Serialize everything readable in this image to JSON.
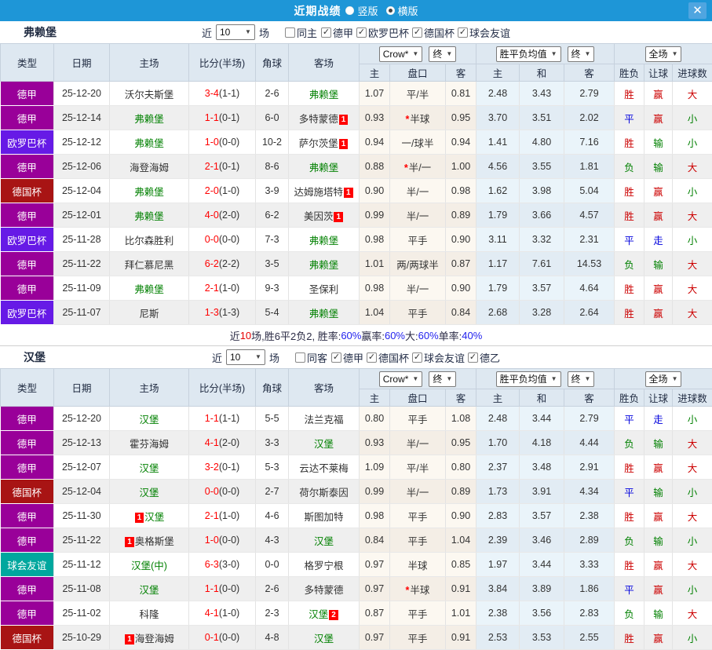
{
  "titlebar": {
    "title": "近期战绩",
    "radios": [
      {
        "label": "竖版",
        "checked": false
      },
      {
        "label": "横版",
        "checked": true
      }
    ],
    "close_label": "✕"
  },
  "filter": {
    "near": "近",
    "games": "场"
  },
  "columns": {
    "type": "类型",
    "date": "日期",
    "home": "主场",
    "score": "比分(半场)",
    "corner": "角球",
    "away": "客场",
    "sub": [
      "主",
      "盘口",
      "客",
      "主",
      "和",
      "客",
      "胜负",
      "让球",
      "进球数"
    ],
    "selects": {
      "bookmaker": "Crow*",
      "final1": "终",
      "avg": "胜平负均值",
      "final2": "终",
      "scope": "全场"
    }
  },
  "league_colors": {
    "德甲": "#990099",
    "欧罗巴杯": "#661ae6",
    "德国杯": "#a81414",
    "球会友谊": "#00a79e"
  },
  "result_colors": {
    "胜": "#cc0000",
    "赢": "#cc0000",
    "大": "#cc0000",
    "平": "#0000dd",
    "走": "#0000dd",
    "负": "#008000",
    "输": "#008000",
    "小": "#008000"
  },
  "accent_colors": {
    "titlebar": "#1e96d7",
    "team_green": "#008000",
    "score_red": "#ff0000"
  },
  "sections": [
    {
      "team": "弗赖堡",
      "count": "10",
      "same": "同主",
      "same_checked": false,
      "leagues": [
        "德甲",
        "欧罗巴杯",
        "德国杯",
        "球会友谊"
      ],
      "summary_parts": [
        {
          "text": "近",
          "color": "#2b2b45"
        },
        {
          "text": "10",
          "color": "#e60000"
        },
        {
          "text": "场,胜6平2负2, 胜率:",
          "color": "#2b2b45"
        },
        {
          "text": "60%",
          "color": "#2222ee"
        },
        {
          "text": " 赢率:",
          "color": "#2b2b45"
        },
        {
          "text": "60%",
          "color": "#2222ee"
        },
        {
          "text": " 大:",
          "color": "#2b2b45"
        },
        {
          "text": "60%",
          "color": "#2222ee"
        },
        {
          "text": " 单率:",
          "color": "#2b2b45"
        },
        {
          "text": "40%",
          "color": "#2222ee"
        }
      ],
      "rows": [
        {
          "type": "德甲",
          "date": "25-12-20",
          "home": "沃尔夫斯堡",
          "home_green": false,
          "home_badge": "",
          "score": "3-4",
          "half": "(1-1)",
          "corner": "2-6",
          "away": "弗赖堡",
          "away_green": true,
          "away_badge": "",
          "ah_home": "1.07",
          "handicap": "平/半",
          "handicap_star": false,
          "ah_away": "0.81",
          "odds_win": "2.48",
          "odds_draw": "3.43",
          "odds_lose": "2.79",
          "res_wdl": "胜",
          "res_ah": "赢",
          "res_goals": "大"
        },
        {
          "type": "德甲",
          "date": "25-12-14",
          "home": "弗赖堡",
          "home_green": true,
          "home_badge": "",
          "score": "1-1",
          "half": "(0-1)",
          "corner": "6-0",
          "away": "多特蒙德",
          "away_green": false,
          "away_badge": "1",
          "ah_home": "0.93",
          "handicap": "半球",
          "handicap_star": true,
          "ah_away": "0.95",
          "odds_win": "3.70",
          "odds_draw": "3.51",
          "odds_lose": "2.02",
          "res_wdl": "平",
          "res_ah": "赢",
          "res_goals": "小"
        },
        {
          "type": "欧罗巴杯",
          "date": "25-12-12",
          "home": "弗赖堡",
          "home_green": true,
          "home_badge": "",
          "score": "1-0",
          "half": "(0-0)",
          "corner": "10-2",
          "away": "萨尔茨堡",
          "away_green": false,
          "away_badge": "1",
          "ah_home": "0.94",
          "handicap": "一/球半",
          "handicap_star": false,
          "ah_away": "0.94",
          "odds_win": "1.41",
          "odds_draw": "4.80",
          "odds_lose": "7.16",
          "res_wdl": "胜",
          "res_ah": "输",
          "res_goals": "小"
        },
        {
          "type": "德甲",
          "date": "25-12-06",
          "home": "海登海姆",
          "home_green": false,
          "home_badge": "",
          "score": "2-1",
          "half": "(0-1)",
          "corner": "8-6",
          "away": "弗赖堡",
          "away_green": true,
          "away_badge": "",
          "ah_home": "0.88",
          "handicap": "半/一",
          "handicap_star": true,
          "ah_away": "1.00",
          "odds_win": "4.56",
          "odds_draw": "3.55",
          "odds_lose": "1.81",
          "res_wdl": "负",
          "res_ah": "输",
          "res_goals": "大"
        },
        {
          "type": "德国杯",
          "date": "25-12-04",
          "home": "弗赖堡",
          "home_green": true,
          "home_badge": "",
          "score": "2-0",
          "half": "(1-0)",
          "corner": "3-9",
          "away": "达姆施塔特",
          "away_green": false,
          "away_badge": "1",
          "ah_home": "0.90",
          "handicap": "半/一",
          "handicap_star": false,
          "ah_away": "0.98",
          "odds_win": "1.62",
          "odds_draw": "3.98",
          "odds_lose": "5.04",
          "res_wdl": "胜",
          "res_ah": "赢",
          "res_goals": "小"
        },
        {
          "type": "德甲",
          "date": "25-12-01",
          "home": "弗赖堡",
          "home_green": true,
          "home_badge": "",
          "score": "4-0",
          "half": "(2-0)",
          "corner": "6-2",
          "away": "美因茨",
          "away_green": false,
          "away_badge": "1",
          "ah_home": "0.99",
          "handicap": "半/一",
          "handicap_star": false,
          "ah_away": "0.89",
          "odds_win": "1.79",
          "odds_draw": "3.66",
          "odds_lose": "4.57",
          "res_wdl": "胜",
          "res_ah": "赢",
          "res_goals": "大"
        },
        {
          "type": "欧罗巴杯",
          "date": "25-11-28",
          "home": "比尔森胜利",
          "home_green": false,
          "home_badge": "",
          "score": "0-0",
          "half": "(0-0)",
          "corner": "7-3",
          "away": "弗赖堡",
          "away_green": true,
          "away_badge": "",
          "ah_home": "0.98",
          "handicap": "平手",
          "handicap_star": false,
          "ah_away": "0.90",
          "odds_win": "3.11",
          "odds_draw": "3.32",
          "odds_lose": "2.31",
          "res_wdl": "平",
          "res_ah": "走",
          "res_goals": "小"
        },
        {
          "type": "德甲",
          "date": "25-11-22",
          "home": "拜仁慕尼黑",
          "home_green": false,
          "home_badge": "",
          "score": "6-2",
          "half": "(2-2)",
          "corner": "3-5",
          "away": "弗赖堡",
          "away_green": true,
          "away_badge": "",
          "ah_home": "1.01",
          "handicap": "两/两球半",
          "handicap_star": false,
          "ah_away": "0.87",
          "odds_win": "1.17",
          "odds_draw": "7.61",
          "odds_lose": "14.53",
          "res_wdl": "负",
          "res_ah": "输",
          "res_goals": "大"
        },
        {
          "type": "德甲",
          "date": "25-11-09",
          "home": "弗赖堡",
          "home_green": true,
          "home_badge": "",
          "score": "2-1",
          "half": "(1-0)",
          "corner": "9-3",
          "away": "圣保利",
          "away_green": false,
          "away_badge": "",
          "ah_home": "0.98",
          "handicap": "半/一",
          "handicap_star": false,
          "ah_away": "0.90",
          "odds_win": "1.79",
          "odds_draw": "3.57",
          "odds_lose": "4.64",
          "res_wdl": "胜",
          "res_ah": "赢",
          "res_goals": "大"
        },
        {
          "type": "欧罗巴杯",
          "date": "25-11-07",
          "home": "尼斯",
          "home_green": false,
          "home_badge": "",
          "score": "1-3",
          "half": "(1-3)",
          "corner": "5-4",
          "away": "弗赖堡",
          "away_green": true,
          "away_badge": "",
          "ah_home": "1.04",
          "handicap": "平手",
          "handicap_star": false,
          "ah_away": "0.84",
          "odds_win": "2.68",
          "odds_draw": "3.28",
          "odds_lose": "2.64",
          "res_wdl": "胜",
          "res_ah": "赢",
          "res_goals": "大"
        }
      ]
    },
    {
      "team": "汉堡",
      "count": "10",
      "same": "同客",
      "same_checked": false,
      "leagues": [
        "德甲",
        "德国杯",
        "球会友谊",
        "德乙"
      ],
      "summary_parts": [],
      "rows": [
        {
          "type": "德甲",
          "date": "25-12-20",
          "home": "汉堡",
          "home_green": true,
          "home_badge": "",
          "score": "1-1",
          "half": "(1-1)",
          "corner": "5-5",
          "away": "法兰克福",
          "away_green": false,
          "away_badge": "",
          "ah_home": "0.80",
          "handicap": "平手",
          "handicap_star": false,
          "ah_away": "1.08",
          "odds_win": "2.48",
          "odds_draw": "3.44",
          "odds_lose": "2.79",
          "res_wdl": "平",
          "res_ah": "走",
          "res_goals": "小"
        },
        {
          "type": "德甲",
          "date": "25-12-13",
          "home": "霍芬海姆",
          "home_green": false,
          "home_badge": "",
          "score": "4-1",
          "half": "(2-0)",
          "corner": "3-3",
          "away": "汉堡",
          "away_green": true,
          "away_badge": "",
          "ah_home": "0.93",
          "handicap": "半/一",
          "handicap_star": false,
          "ah_away": "0.95",
          "odds_win": "1.70",
          "odds_draw": "4.18",
          "odds_lose": "4.44",
          "res_wdl": "负",
          "res_ah": "输",
          "res_goals": "大"
        },
        {
          "type": "德甲",
          "date": "25-12-07",
          "home": "汉堡",
          "home_green": true,
          "home_badge": "",
          "score": "3-2",
          "half": "(0-1)",
          "corner": "5-3",
          "away": "云达不莱梅",
          "away_green": false,
          "away_badge": "",
          "ah_home": "1.09",
          "handicap": "平/半",
          "handicap_star": false,
          "ah_away": "0.80",
          "odds_win": "2.37",
          "odds_draw": "3.48",
          "odds_lose": "2.91",
          "res_wdl": "胜",
          "res_ah": "赢",
          "res_goals": "大"
        },
        {
          "type": "德国杯",
          "date": "25-12-04",
          "home": "汉堡",
          "home_green": true,
          "home_badge": "",
          "score": "0-0",
          "half": "(0-0)",
          "corner": "2-7",
          "away": "荷尔斯泰因",
          "away_green": false,
          "away_badge": "",
          "ah_home": "0.99",
          "handicap": "半/一",
          "handicap_star": false,
          "ah_away": "0.89",
          "odds_win": "1.73",
          "odds_draw": "3.91",
          "odds_lose": "4.34",
          "res_wdl": "平",
          "res_ah": "输",
          "res_goals": "小"
        },
        {
          "type": "德甲",
          "date": "25-11-30",
          "home": "汉堡",
          "home_green": true,
          "home_badge": "1",
          "score": "2-1",
          "half": "(1-0)",
          "corner": "4-6",
          "away": "斯图加特",
          "away_green": false,
          "away_badge": "",
          "ah_home": "0.98",
          "handicap": "平手",
          "handicap_star": false,
          "ah_away": "0.90",
          "odds_win": "2.83",
          "odds_draw": "3.57",
          "odds_lose": "2.38",
          "res_wdl": "胜",
          "res_ah": "赢",
          "res_goals": "大"
        },
        {
          "type": "德甲",
          "date": "25-11-22",
          "home": "奥格斯堡",
          "home_green": false,
          "home_badge": "1",
          "score": "1-0",
          "half": "(0-0)",
          "corner": "4-3",
          "away": "汉堡",
          "away_green": true,
          "away_badge": "",
          "ah_home": "0.84",
          "handicap": "平手",
          "handicap_star": false,
          "ah_away": "1.04",
          "odds_win": "2.39",
          "odds_draw": "3.46",
          "odds_lose": "2.89",
          "res_wdl": "负",
          "res_ah": "输",
          "res_goals": "小"
        },
        {
          "type": "球会友谊",
          "date": "25-11-12",
          "home": "汉堡(中)",
          "home_green": true,
          "home_badge": "",
          "score": "6-3",
          "half": "(3-0)",
          "corner": "0-0",
          "away": "格罗宁根",
          "away_green": false,
          "away_badge": "",
          "ah_home": "0.97",
          "handicap": "半球",
          "handicap_star": false,
          "ah_away": "0.85",
          "odds_win": "1.97",
          "odds_draw": "3.44",
          "odds_lose": "3.33",
          "res_wdl": "胜",
          "res_ah": "赢",
          "res_goals": "大"
        },
        {
          "type": "德甲",
          "date": "25-11-08",
          "home": "汉堡",
          "home_green": true,
          "home_badge": "",
          "score": "1-1",
          "half": "(0-0)",
          "corner": "2-6",
          "away": "多特蒙德",
          "away_green": false,
          "away_badge": "",
          "ah_home": "0.97",
          "handicap": "半球",
          "handicap_star": true,
          "ah_away": "0.91",
          "odds_win": "3.84",
          "odds_draw": "3.89",
          "odds_lose": "1.86",
          "res_wdl": "平",
          "res_ah": "赢",
          "res_goals": "小"
        },
        {
          "type": "德甲",
          "date": "25-11-02",
          "home": "科隆",
          "home_green": false,
          "home_badge": "",
          "score": "4-1",
          "half": "(1-0)",
          "corner": "2-3",
          "away": "汉堡",
          "away_green": true,
          "away_badge": "2",
          "ah_home": "0.87",
          "handicap": "平手",
          "handicap_star": false,
          "ah_away": "1.01",
          "odds_win": "2.38",
          "odds_draw": "3.56",
          "odds_lose": "2.83",
          "res_wdl": "负",
          "res_ah": "输",
          "res_goals": "大"
        },
        {
          "type": "德国杯",
          "date": "25-10-29",
          "home": "海登海姆",
          "home_green": false,
          "home_badge": "1",
          "score": "0-1",
          "half": "(0-0)",
          "corner": "4-8",
          "away": "汉堡",
          "away_green": true,
          "away_badge": "",
          "ah_home": "0.97",
          "handicap": "平手",
          "handicap_star": false,
          "ah_away": "0.91",
          "odds_win": "2.53",
          "odds_draw": "3.53",
          "odds_lose": "2.55",
          "res_wdl": "胜",
          "res_ah": "赢",
          "res_goals": "小"
        }
      ]
    }
  ]
}
